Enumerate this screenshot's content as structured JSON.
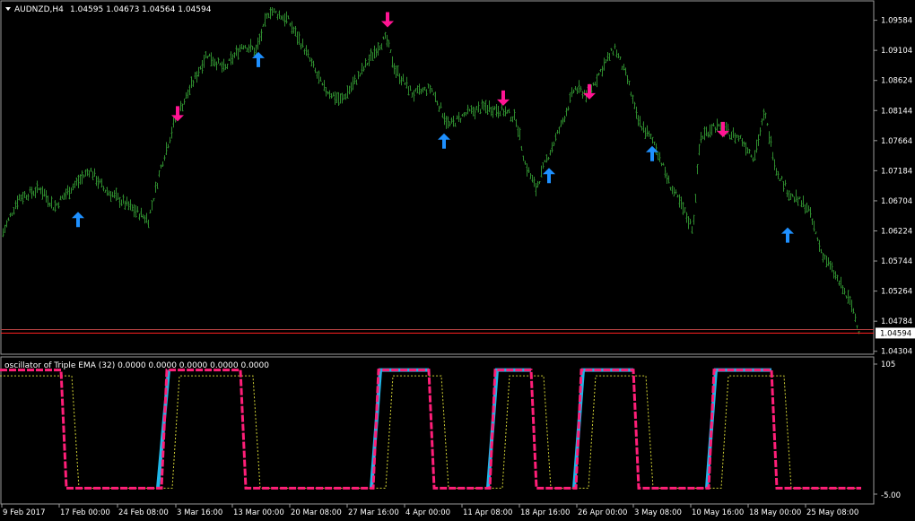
{
  "header": {
    "symbol": "AUDNZD,H4",
    "ohlc": "1.04595 1.04673 1.04564 1.04594"
  },
  "indicator": {
    "title": "oscillator of Triple EMA (32) 0.0000 0.0000 0.0000 0.0000 0.0000",
    "scale_top": "105",
    "scale_bottom": "-5.00"
  },
  "price_axis": {
    "ticks": [
      "1.09584",
      "1.09104",
      "1.08624",
      "1.08144",
      "1.07664",
      "1.07184",
      "1.06704",
      "1.06224",
      "1.05744",
      "1.05264",
      "1.04784",
      "1.04304"
    ],
    "current_price": "1.04594"
  },
  "time_axis": {
    "ticks": [
      "9 Feb 2017",
      "17 Feb 00:00",
      "24 Feb 08:00",
      "3 Mar 16:00",
      "13 Mar 00:00",
      "20 Mar 08:00",
      "27 Mar 16:00",
      "4 Apr 00:00",
      "11 Apr 08:00",
      "18 Apr 16:00",
      "26 Apr 00:00",
      "3 May 08:00",
      "10 May 16:00",
      "18 May 00:00",
      "25 May 08:00"
    ]
  },
  "colors": {
    "background": "#000000",
    "bars": "#2e8b2e",
    "up_arrow": "#1e90ff",
    "down_arrow": "#ff1493",
    "osc_main": "#ff1e78",
    "osc_signal": "#1fb6e8",
    "osc_dotted": "#cccc33",
    "price_line": "#ff2020"
  },
  "chart_data": {
    "type": "line",
    "title": "AUDNZD,H4",
    "ylim": [
      1.043,
      1.0985
    ],
    "x": [
      "9 Feb 2017",
      "17 Feb 00:00",
      "24 Feb 08:00",
      "3 Mar 16:00",
      "13 Mar 00:00",
      "20 Mar 08:00",
      "27 Mar 16:00",
      "4 Apr 00:00",
      "11 Apr 08:00",
      "18 Apr 16:00",
      "26 Apr 00:00",
      "3 May 08:00",
      "10 May 16:00",
      "18 May 00:00",
      "25 May 08:00"
    ],
    "price_path": [
      [
        0,
        1.061
      ],
      [
        20,
        1.0675
      ],
      [
        45,
        1.069
      ],
      [
        60,
        1.066
      ],
      [
        75,
        1.0685
      ],
      [
        100,
        1.072
      ],
      [
        115,
        1.069
      ],
      [
        135,
        1.067
      ],
      [
        155,
        1.065
      ],
      [
        165,
        1.064
      ],
      [
        180,
        1.073
      ],
      [
        195,
        1.08
      ],
      [
        215,
        1.086
      ],
      [
        230,
        1.0905
      ],
      [
        250,
        1.088
      ],
      [
        270,
        1.092
      ],
      [
        285,
        1.091
      ],
      [
        300,
        1.0975
      ],
      [
        320,
        1.096
      ],
      [
        340,
        1.091
      ],
      [
        360,
        1.085
      ],
      [
        380,
        1.083
      ],
      [
        400,
        1.087
      ],
      [
        420,
        1.0915
      ],
      [
        430,
        1.093
      ],
      [
        440,
        1.088
      ],
      [
        460,
        1.084
      ],
      [
        480,
        1.085
      ],
      [
        500,
        1.079
      ],
      [
        520,
        1.081
      ],
      [
        540,
        1.082
      ],
      [
        560,
        1.0815
      ],
      [
        575,
        1.08
      ],
      [
        585,
        1.073
      ],
      [
        597,
        1.069
      ],
      [
        610,
        1.074
      ],
      [
        625,
        1.079
      ],
      [
        640,
        1.085
      ],
      [
        655,
        1.084
      ],
      [
        670,
        1.088
      ],
      [
        685,
        1.0915
      ],
      [
        700,
        1.086
      ],
      [
        710,
        1.08
      ],
      [
        730,
        1.076
      ],
      [
        745,
        1.07
      ],
      [
        760,
        1.066
      ],
      [
        772,
        1.0625
      ],
      [
        780,
        1.077
      ],
      [
        795,
        1.079
      ],
      [
        810,
        1.078
      ],
      [
        825,
        1.077
      ],
      [
        840,
        1.074
      ],
      [
        852,
        1.081
      ],
      [
        865,
        1.072
      ],
      [
        880,
        1.068
      ],
      [
        900,
        1.066
      ],
      [
        915,
        1.059
      ],
      [
        935,
        1.054
      ],
      [
        950,
        1.05
      ],
      [
        958,
        1.0459
      ]
    ],
    "up_signals": [
      {
        "x": 87,
        "price": 1.064
      },
      {
        "x": 288,
        "price": 1.0895
      },
      {
        "x": 495,
        "price": 1.0765
      },
      {
        "x": 612,
        "price": 1.071
      },
      {
        "x": 727,
        "price": 1.0745
      },
      {
        "x": 878,
        "price": 1.0615
      }
    ],
    "down_signals": [
      {
        "x": 198,
        "price": 1.081
      },
      {
        "x": 432,
        "price": 1.096
      },
      {
        "x": 561,
        "price": 1.0835
      },
      {
        "x": 657,
        "price": 1.0845
      },
      {
        "x": 806,
        "price": 1.0785
      }
    ],
    "oscillator": {
      "ylim": [
        -5,
        105
      ],
      "main": [
        [
          0,
          100
        ],
        [
          68,
          100
        ],
        [
          74,
          0
        ],
        [
          180,
          0
        ],
        [
          186,
          100
        ],
        [
          268,
          100
        ],
        [
          274,
          0
        ],
        [
          416,
          0
        ],
        [
          422,
          100
        ],
        [
          478,
          100
        ],
        [
          484,
          0
        ],
        [
          546,
          0
        ],
        [
          552,
          100
        ],
        [
          592,
          100
        ],
        [
          598,
          0
        ],
        [
          642,
          0
        ],
        [
          648,
          100
        ],
        [
          706,
          100
        ],
        [
          712,
          0
        ],
        [
          790,
          0
        ],
        [
          796,
          100
        ],
        [
          860,
          100
        ],
        [
          866,
          0
        ],
        [
          960,
          0
        ]
      ],
      "signal": [
        [
          176,
          0
        ],
        [
          188,
          100
        ],
        [
          414,
          0
        ],
        [
          424,
          100
        ],
        [
          544,
          0
        ],
        [
          554,
          100
        ],
        [
          640,
          0
        ],
        [
          650,
          100
        ],
        [
          788,
          0
        ],
        [
          798,
          100
        ]
      ],
      "dotted": [
        [
          0,
          95
        ],
        [
          80,
          95
        ],
        [
          88,
          0
        ],
        [
          192,
          0
        ],
        [
          200,
          95
        ],
        [
          282,
          95
        ],
        [
          290,
          0
        ],
        [
          430,
          0
        ],
        [
          438,
          95
        ],
        [
          492,
          95
        ],
        [
          500,
          0
        ],
        [
          560,
          0
        ],
        [
          568,
          95
        ],
        [
          606,
          95
        ],
        [
          614,
          0
        ],
        [
          656,
          0
        ],
        [
          664,
          95
        ],
        [
          720,
          95
        ],
        [
          728,
          0
        ],
        [
          804,
          0
        ],
        [
          812,
          95
        ],
        [
          874,
          95
        ],
        [
          882,
          0
        ],
        [
          960,
          0
        ]
      ]
    }
  }
}
